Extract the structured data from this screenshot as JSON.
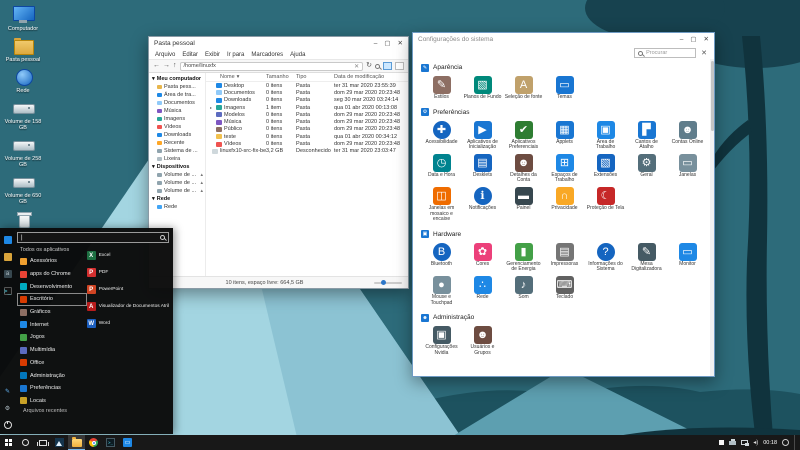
{
  "colors": {
    "accent_blue": "#1e88e5",
    "taskbar_bg": "#181818",
    "wallpaper_sky": "#2d6b7a",
    "wallpaper_mountain_light": "#a3d5e1",
    "wallpaper_dark": "#10333d"
  },
  "glyphs": {
    "minimize": "–",
    "maximize": "▢",
    "close": "✕",
    "back": "←",
    "forward": "→",
    "up": "↑",
    "refresh": "↻",
    "sort_indicator": "▾",
    "section_arrow": "▾",
    "caret": "|",
    "prompt": ">_"
  },
  "desktop": {
    "icons": [
      {
        "label": "Computador",
        "type": "computer",
        "icon": "computer-icon"
      },
      {
        "label": "Pasta pessoal",
        "type": "homefolder",
        "icon": "home-folder-icon"
      },
      {
        "label": "Rede",
        "type": "network",
        "icon": "network-icon"
      },
      {
        "label": "Volume de 158 GB",
        "type": "drive",
        "icon": "drive-icon"
      },
      {
        "label": "Volume de 258 GB",
        "type": "drive",
        "icon": "drive-icon"
      },
      {
        "label": "Volume de 650 GB",
        "type": "drive",
        "icon": "drive-icon"
      },
      {
        "label": "Lixeira",
        "type": "trash",
        "icon": "trash-icon"
      }
    ]
  },
  "file_manager": {
    "title": "Pasta pessoal",
    "menu": [
      "Arquivo",
      "Editar",
      "Exibir",
      "Ir para",
      "Marcadores",
      "Ajuda"
    ],
    "path": "/home/linuxfx",
    "sidebar": {
      "computer": {
        "label": "Meu computador",
        "items": [
          {
            "label": "Pasta pess...",
            "color": "#e8b64c"
          },
          {
            "label": "Área de tra...",
            "color": "#1e88e5"
          },
          {
            "label": "Documentos",
            "color": "#90caf9"
          },
          {
            "label": "Música",
            "color": "#7e57c2"
          },
          {
            "label": "Imagens",
            "color": "#26a69a"
          },
          {
            "label": "Vídeos",
            "color": "#ef5350"
          },
          {
            "label": "Downloads",
            "color": "#1e88e5"
          },
          {
            "label": "Recente",
            "color": "#ffa726"
          },
          {
            "label": "Sistema de ...",
            "color": "#90a4ae"
          },
          {
            "label": "Lixeira",
            "color": "#b0bec5"
          }
        ]
      },
      "devices": {
        "label": "Dispositivos",
        "items": [
          {
            "label": "Volume de ...",
            "color": "#90a4ae",
            "eject": "▴"
          },
          {
            "label": "Volume de ...",
            "color": "#90a4ae",
            "eject": "▴"
          },
          {
            "label": "Volume de ...",
            "color": "#90a4ae",
            "eject": "▴"
          }
        ]
      },
      "network": {
        "label": "Rede",
        "items": [
          {
            "label": "Rede",
            "color": "#42a5f5",
            "eject": ""
          }
        ]
      }
    },
    "columns": [
      "Nome",
      "Tamanho",
      "Tipo",
      "Data de modificação"
    ],
    "rows": [
      {
        "name": "Desktop",
        "exp": "",
        "color": "#1e88e5",
        "size": "0 itens",
        "type": "Pasta",
        "modified": "ter 31 mar 2020 23:55:39"
      },
      {
        "name": "Documentos",
        "exp": "",
        "color": "#90caf9",
        "size": "0 itens",
        "type": "Pasta",
        "modified": "dom 29 mar 2020 20:23:48"
      },
      {
        "name": "Downloads",
        "exp": "",
        "color": "#1e88e5",
        "size": "0 itens",
        "type": "Pasta",
        "modified": "seg 30 mar 2020 03:24:14"
      },
      {
        "name": "Imagens",
        "exp": "▸",
        "color": "#26a69a",
        "size": "1 item",
        "type": "Pasta",
        "modified": "qua 01 abr 2020 00:13:08"
      },
      {
        "name": "Modelos",
        "exp": "",
        "color": "#5c6bc0",
        "size": "0 itens",
        "type": "Pasta",
        "modified": "dom 29 mar 2020 20:23:48"
      },
      {
        "name": "Música",
        "exp": "",
        "color": "#7e57c2",
        "size": "0 itens",
        "type": "Pasta",
        "modified": "dom 29 mar 2020 20:23:48"
      },
      {
        "name": "Público",
        "exp": "",
        "color": "#8d6e63",
        "size": "0 itens",
        "type": "Pasta",
        "modified": "dom 29 mar 2020 20:23:48"
      },
      {
        "name": "teste",
        "exp": "",
        "color": "#f2c14e",
        "size": "0 itens",
        "type": "Pasta",
        "modified": "qua 01 abr 2020 00:34:12"
      },
      {
        "name": "Vídeos",
        "exp": "",
        "color": "#ef5350",
        "size": "0 itens",
        "type": "Pasta",
        "modified": "dom 29 mar 2020 20:23:48"
      },
      {
        "name": "linuxfx10-src-fix-beta.iso",
        "exp": "",
        "color": "#cfd8dc",
        "size": "3,2 GB",
        "type": "Desconhecido",
        "modified": "ter 31 mar 2020 23:03:47"
      }
    ],
    "status": "10 itens, espaço livre: 664,5 GB"
  },
  "settings": {
    "title": "Configurações do sistema",
    "search_placeholder": "Procurar",
    "aparencia": {
      "label": "Aparência",
      "items": [
        {
          "label": "Estilos",
          "glyph": "✎",
          "color": "#8d6e63",
          "shape": ""
        },
        {
          "label": "Planos de Fundo",
          "glyph": "▧",
          "color": "#00897b",
          "shape": ""
        },
        {
          "label": "Seleção de fonte",
          "glyph": "A",
          "color": "#c0a16b",
          "shape": ""
        },
        {
          "label": "Temas",
          "glyph": "▭",
          "color": "#1976d2",
          "shape": ""
        }
      ]
    },
    "preferencias": {
      "label": "Preferências",
      "items": [
        {
          "label": "Acessibilidade",
          "glyph": "✚",
          "color": "#1565c0",
          "shape": "circle"
        },
        {
          "label": "Aplicativos de Inicialização",
          "glyph": "▶",
          "color": "#1976d2",
          "shape": ""
        },
        {
          "label": "Aplicativos Preferenciais",
          "glyph": "✔",
          "color": "#2e7d32",
          "shape": ""
        },
        {
          "label": "Applets",
          "glyph": "▦",
          "color": "#1976d2",
          "shape": ""
        },
        {
          "label": "Área de Trabalho",
          "glyph": "▣",
          "color": "#1e88e5",
          "shape": ""
        },
        {
          "label": "Cantos de Atalho",
          "glyph": "▛",
          "color": "#1976d2",
          "shape": ""
        },
        {
          "label": "Contas Online",
          "glyph": "☻",
          "color": "#607d8b",
          "shape": ""
        },
        {
          "label": "Data e Hora",
          "glyph": "◷",
          "color": "#00838f",
          "shape": ""
        },
        {
          "label": "Desklets",
          "glyph": "▤",
          "color": "#1565c0",
          "shape": ""
        },
        {
          "label": "Detalhes da Conta",
          "glyph": "☻",
          "color": "#6d4c41",
          "shape": ""
        },
        {
          "label": "Espaços de Trabalho",
          "glyph": "⊞",
          "color": "#1e88e5",
          "shape": ""
        },
        {
          "label": "Extensões",
          "glyph": "▧",
          "color": "#1565c0",
          "shape": ""
        },
        {
          "label": "Geral",
          "glyph": "⚙",
          "color": "#546e7a",
          "shape": ""
        },
        {
          "label": "Janelas",
          "glyph": "▭",
          "color": "#78909c",
          "shape": ""
        },
        {
          "label": "Janelas em mosaico e encaixe",
          "glyph": "◫",
          "color": "#ef6c00",
          "shape": ""
        },
        {
          "label": "Notificações",
          "glyph": "ℹ",
          "color": "#1565c0",
          "shape": "circle"
        },
        {
          "label": "Painel",
          "glyph": "▬",
          "color": "#37474f",
          "shape": ""
        },
        {
          "label": "Privacidade",
          "glyph": "∩",
          "color": "#f9a825",
          "shape": ""
        },
        {
          "label": "Proteção de Tela",
          "glyph": "☾",
          "color": "#c62828",
          "shape": ""
        }
      ]
    },
    "hardware": {
      "label": "Hardware",
      "items": [
        {
          "label": "Bluetooth",
          "glyph": "B",
          "color": "#1565c0",
          "shape": "circle"
        },
        {
          "label": "Cores",
          "glyph": "✿",
          "color": "#ec407a",
          "shape": ""
        },
        {
          "label": "Gerenciamento de Energia",
          "glyph": "▮",
          "color": "#43a047",
          "shape": ""
        },
        {
          "label": "Impressoras",
          "glyph": "▤",
          "color": "#757575",
          "shape": ""
        },
        {
          "label": "Informações do Sistema",
          "glyph": "?",
          "color": "#1565c0",
          "shape": "circle"
        },
        {
          "label": "Mesa Digitalizadora",
          "glyph": "✎",
          "color": "#455a64",
          "shape": ""
        },
        {
          "label": "Monitor",
          "glyph": "▭",
          "color": "#1e88e5",
          "shape": ""
        },
        {
          "label": "Mouse e Touchpad",
          "glyph": "●",
          "color": "#78909c",
          "shape": ""
        },
        {
          "label": "Rede",
          "glyph": "∴",
          "color": "#1e88e5",
          "shape": ""
        },
        {
          "label": "Som",
          "glyph": "♪",
          "color": "#546e7a",
          "shape": ""
        },
        {
          "label": "Teclado",
          "glyph": "⌨",
          "color": "#616161",
          "shape": ""
        }
      ]
    },
    "administracao": {
      "label": "Administração",
      "items": [
        {
          "label": "Configurações Nvidia",
          "glyph": "▣",
          "color": "#455a64",
          "shape": ""
        },
        {
          "label": "Usuários e Grupos",
          "glyph": "☻",
          "color": "#6d4c41",
          "shape": ""
        }
      ]
    }
  },
  "start_menu": {
    "search_value": "",
    "all_apps_label": "Todos os aplicativos",
    "categories": [
      {
        "label": "Acessórios",
        "color": "#f0a030",
        "cls": ""
      },
      {
        "label": "apps do Chrome",
        "color": "#ea4335",
        "cls": ""
      },
      {
        "label": "Desenvolvimento",
        "color": "#00acc1",
        "cls": ""
      },
      {
        "label": "Escritório",
        "color": "#d83b01",
        "cls": "selected"
      },
      {
        "label": "Gráficos",
        "color": "#8d6e63",
        "cls": ""
      },
      {
        "label": "Internet",
        "color": "#1e88e5",
        "cls": ""
      },
      {
        "label": "Jogos",
        "color": "#43a047",
        "cls": ""
      },
      {
        "label": "Multimídia",
        "color": "#5c6bc0",
        "cls": ""
      },
      {
        "label": "Office",
        "color": "#d83b01",
        "cls": ""
      },
      {
        "label": "Administração",
        "color": "#0277bd",
        "cls": ""
      },
      {
        "label": "Preferências",
        "color": "#1976d2",
        "cls": ""
      },
      {
        "label": "Locais",
        "color": "#c9a227",
        "cls": ""
      }
    ],
    "apps": [
      {
        "label": "Excel",
        "letter": "X",
        "color": "#1d6f42"
      },
      {
        "label": "PDF",
        "letter": "P",
        "color": "#d32f2f"
      },
      {
        "label": "PowerPoint",
        "letter": "P",
        "color": "#d04423"
      },
      {
        "label": "Visualizador de Documentos Atril",
        "letter": "A",
        "color": "#b71c1c"
      },
      {
        "label": "Word",
        "letter": "W",
        "color": "#1b5ebe"
      }
    ],
    "recent_label": "Arquivos recentes"
  },
  "taskbar": {
    "clock": "00:18"
  }
}
